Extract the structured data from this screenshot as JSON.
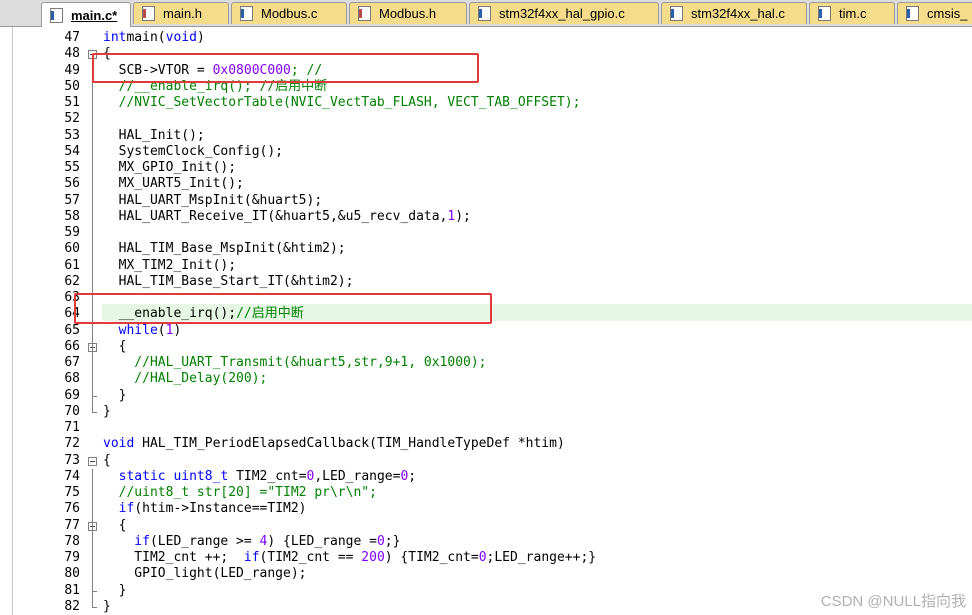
{
  "tabs": [
    {
      "label": "main.c*",
      "icon": "c-file-icon",
      "active": true
    },
    {
      "label": "main.h",
      "icon": "h-file-icon",
      "active": false
    },
    {
      "label": "Modbus.c",
      "icon": "c-file-icon",
      "active": false
    },
    {
      "label": "Modbus.h",
      "icon": "h-file-icon",
      "active": false
    },
    {
      "label": "stm32f4xx_hal_gpio.c",
      "icon": "c-file-icon",
      "active": false
    },
    {
      "label": "stm32f4xx_hal.c",
      "icon": "c-file-icon",
      "active": false
    },
    {
      "label": "tim.c",
      "icon": "c-file-icon",
      "active": false
    },
    {
      "label": "cmsis_",
      "icon": "c-file-icon",
      "active": false
    }
  ],
  "colors": {
    "keyword": "#0000ff",
    "comment": "#008000",
    "number": "#8000ff",
    "highlight_box": "#e03a3a",
    "current_line": "#e6f7e6"
  },
  "lines": [
    {
      "n": "47",
      "tokens": [
        [
          "kw",
          "int"
        ],
        [
          "",
          "main("
        ],
        [
          "kw",
          "void"
        ],
        [
          "",
          ")"
        ]
      ]
    },
    {
      "n": "48",
      "tokens": [
        [
          "",
          "{"
        ]
      ]
    },
    {
      "n": "49",
      "tokens": [
        [
          "",
          "  SCB->VTOR = "
        ],
        [
          "num",
          "0x0800C000"
        ],
        [
          "cm",
          "; //"
        ]
      ]
    },
    {
      "n": "50",
      "tokens": [
        [
          "cm",
          "  //__enable_irq(); //启用中断"
        ]
      ]
    },
    {
      "n": "51",
      "tokens": [
        [
          "cm",
          "  //NVIC_SetVectorTable(NVIC_VectTab_FLASH, VECT_TAB_OFFSET);"
        ]
      ]
    },
    {
      "n": "52",
      "tokens": []
    },
    {
      "n": "53",
      "tokens": [
        [
          "",
          "  HAL_Init();"
        ]
      ]
    },
    {
      "n": "54",
      "tokens": [
        [
          "",
          "  SystemClock_Config();"
        ]
      ]
    },
    {
      "n": "55",
      "tokens": [
        [
          "",
          "  MX_GPIO_Init();"
        ]
      ]
    },
    {
      "n": "56",
      "tokens": [
        [
          "",
          "  MX_UART5_Init();"
        ]
      ]
    },
    {
      "n": "57",
      "tokens": [
        [
          "",
          "  HAL_UART_MspInit(&huart5);"
        ]
      ]
    },
    {
      "n": "58",
      "tokens": [
        [
          "",
          "  HAL_UART_Receive_IT(&huart5,&u5_recv_data,"
        ],
        [
          "num",
          "1"
        ],
        [
          "",
          ");"
        ]
      ]
    },
    {
      "n": "59",
      "tokens": []
    },
    {
      "n": "60",
      "tokens": [
        [
          "",
          "  HAL_TIM_Base_MspInit(&htim2);"
        ]
      ]
    },
    {
      "n": "61",
      "tokens": [
        [
          "",
          "  MX_TIM2_Init();"
        ]
      ]
    },
    {
      "n": "62",
      "tokens": [
        [
          "",
          "  HAL_TIM_Base_Start_IT(&htim2);"
        ]
      ]
    },
    {
      "n": "63",
      "tokens": []
    },
    {
      "n": "64",
      "tokens": [
        [
          "",
          "  __enable_irq();"
        ],
        [
          "cm",
          "//启用中断"
        ]
      ]
    },
    {
      "n": "65",
      "tokens": [
        [
          "kw",
          "  while"
        ],
        [
          "",
          "("
        ],
        [
          "num",
          "1"
        ],
        [
          "",
          ")"
        ]
      ]
    },
    {
      "n": "66",
      "tokens": [
        [
          "",
          "  {"
        ]
      ]
    },
    {
      "n": "67",
      "tokens": [
        [
          "cm",
          "    //HAL_UART_Transmit(&huart5,str,9+1, 0x1000);"
        ]
      ]
    },
    {
      "n": "68",
      "tokens": [
        [
          "cm",
          "    //HAL_Delay(200);"
        ]
      ]
    },
    {
      "n": "69",
      "tokens": [
        [
          "",
          "  }"
        ]
      ]
    },
    {
      "n": "70",
      "tokens": [
        [
          "",
          "}"
        ]
      ]
    },
    {
      "n": "71",
      "tokens": []
    },
    {
      "n": "72",
      "tokens": [
        [
          "kw",
          "void"
        ],
        [
          "",
          " HAL_TIM_PeriodElapsedCallback(TIM_HandleTypeDef *htim)"
        ]
      ]
    },
    {
      "n": "73",
      "tokens": [
        [
          "",
          "{"
        ]
      ]
    },
    {
      "n": "74",
      "tokens": [
        [
          "kw",
          "  static"
        ],
        [
          "",
          ""
        ],
        [
          "kw",
          " uint8_t"
        ],
        [
          "",
          " TIM2_cnt="
        ],
        [
          "num",
          "0"
        ],
        [
          "",
          ",LED_range="
        ],
        [
          "num",
          "0"
        ],
        [
          "",
          ";"
        ]
      ]
    },
    {
      "n": "75",
      "tokens": [
        [
          "cm",
          "  //uint8_t str[20] =\"TIM2 pr\\r\\n\";"
        ]
      ]
    },
    {
      "n": "76",
      "tokens": [
        [
          "kw",
          "  if"
        ],
        [
          "",
          "(htim->Instance==TIM2)"
        ]
      ]
    },
    {
      "n": "77",
      "tokens": [
        [
          "",
          "  {"
        ]
      ]
    },
    {
      "n": "78",
      "tokens": [
        [
          "kw",
          "    if"
        ],
        [
          "",
          "(LED_range >= "
        ],
        [
          "num",
          "4"
        ],
        [
          "",
          ") {LED_range ="
        ],
        [
          "num",
          "0"
        ],
        [
          "",
          ";}"
        ]
      ]
    },
    {
      "n": "79",
      "tokens": [
        [
          "",
          "    TIM2_cnt ++;  "
        ],
        [
          "kw",
          "if"
        ],
        [
          "",
          "(TIM2_cnt == "
        ],
        [
          "num",
          "200"
        ],
        [
          "",
          ") {TIM2_cnt="
        ],
        [
          "num",
          "0"
        ],
        [
          "",
          ";LED_range++;}"
        ]
      ]
    },
    {
      "n": "80",
      "tokens": [
        [
          "",
          "    GPIO_light(LED_range);"
        ]
      ]
    },
    {
      "n": "81",
      "tokens": [
        [
          "",
          "  }"
        ]
      ]
    },
    {
      "n": "82",
      "tokens": [
        [
          "",
          "}"
        ]
      ]
    }
  ],
  "watermark": "CSDN @NULL指向我"
}
